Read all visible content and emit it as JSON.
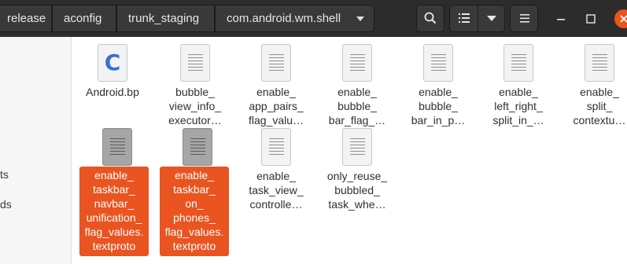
{
  "breadcrumbs": [
    {
      "label": "release"
    },
    {
      "label": "aconfig"
    },
    {
      "label": "trunk_staging"
    },
    {
      "label": "com.android.wm.shell"
    }
  ],
  "sidebar": {
    "items": [
      {
        "label": "ts"
      },
      {
        "label": "ds"
      }
    ]
  },
  "files": [
    {
      "icon": "c-source-icon",
      "lines": [
        "Android.bp"
      ]
    },
    {
      "icon": "text-document-icon",
      "lines": [
        "bubble_",
        "view_info_",
        "executor…"
      ]
    },
    {
      "icon": "text-document-icon",
      "lines": [
        "enable_",
        "app_pairs_",
        "flag_valu…"
      ]
    },
    {
      "icon": "text-document-icon",
      "lines": [
        "enable_",
        "bubble_",
        "bar_flag_…"
      ]
    },
    {
      "icon": "text-document-icon",
      "lines": [
        "enable_",
        "bubble_",
        "bar_in_p…"
      ]
    },
    {
      "icon": "text-document-icon",
      "lines": [
        "enable_",
        "left_right_",
        "split_in_…"
      ]
    },
    {
      "icon": "text-document-icon",
      "lines": [
        "enable_",
        "split_",
        "contextu…"
      ]
    },
    {
      "icon": "text-document-icon",
      "selected": true,
      "lines": [
        "enable_",
        "taskbar_",
        "navbar_",
        "unification_",
        "flag_values.",
        "textproto"
      ]
    },
    {
      "icon": "text-document-icon",
      "selected": true,
      "lines": [
        "enable_",
        "taskbar_",
        "on_",
        "phones_",
        "flag_values.",
        "textproto"
      ]
    },
    {
      "icon": "text-document-icon",
      "lines": [
        "enable_",
        "task_view_",
        "controlle…"
      ]
    },
    {
      "icon": "text-document-icon",
      "lines": [
        "only_reuse_",
        "bubbled_",
        "task_whe…"
      ]
    }
  ],
  "colors": {
    "header_bg": "#2c2c2c",
    "selection": "#e95420",
    "c_icon_letter": "#3d6fd1"
  },
  "header_buttons": [
    "search-icon",
    "list-view-icon",
    "chevron-down-icon",
    "hamburger-menu-icon",
    "minimize-icon",
    "maximize-icon",
    "close-icon"
  ],
  "c_icon_letter": "C"
}
